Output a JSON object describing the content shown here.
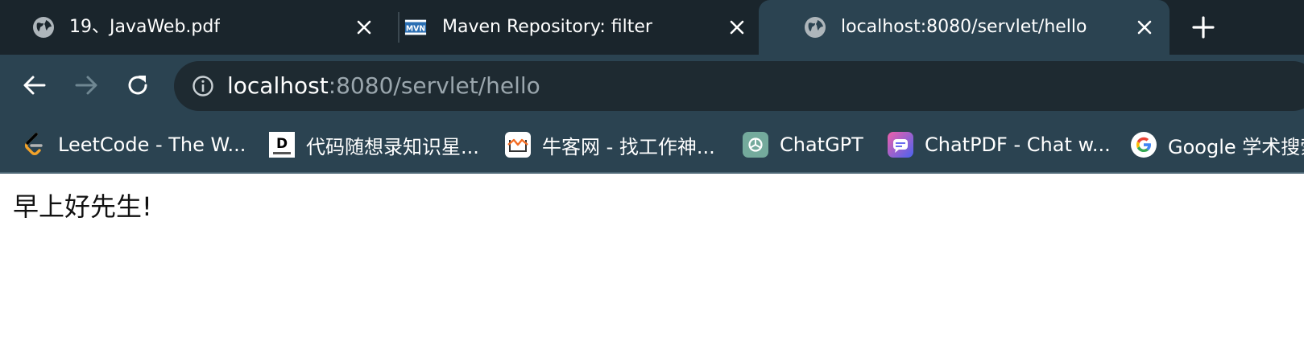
{
  "tabs": [
    {
      "title": "19、JavaWeb.pdf",
      "icon": "globe-icon",
      "active": false
    },
    {
      "title": "Maven Repository: filter",
      "icon": "mvn-logo-icon",
      "active": false
    },
    {
      "title": "localhost:8080/servlet/hello",
      "icon": "globe-icon",
      "active": true
    }
  ],
  "address_bar": {
    "host": "localhost",
    "rest": ":8080/servlet/hello"
  },
  "bookmarks": [
    {
      "label": "LeetCode - The W...",
      "icon": "leetcode-icon"
    },
    {
      "label": "代码随想录知识星...",
      "icon": "dmsxl-icon"
    },
    {
      "label": "牛客网 - 找工作神...",
      "icon": "nowcoder-icon"
    },
    {
      "label": "ChatGPT",
      "icon": "chatgpt-icon"
    },
    {
      "label": "ChatPDF - Chat w...",
      "icon": "chatpdf-icon"
    },
    {
      "label": "Google 学术搜索",
      "icon": "google-icon"
    }
  ],
  "page": {
    "text": "早上好先生!"
  },
  "colors": {
    "tabstrip": "#1a252c",
    "toolbar": "#2b4351",
    "omnibox": "#1e2a31"
  }
}
